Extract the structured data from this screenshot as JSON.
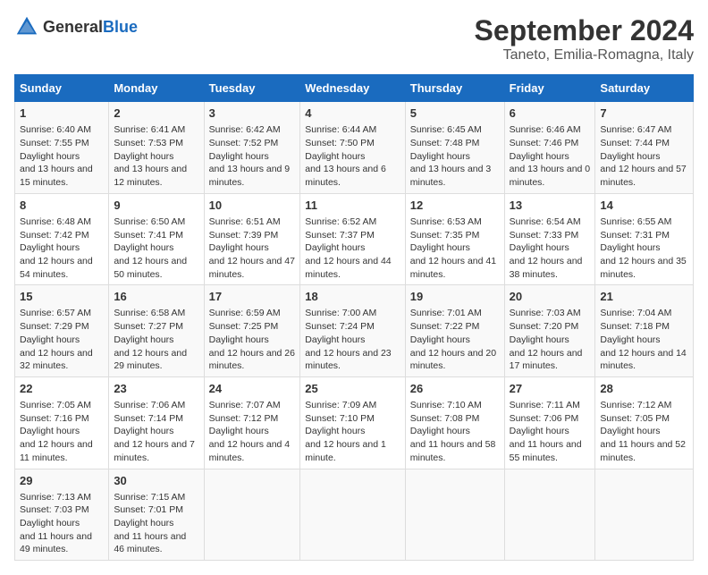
{
  "logo": {
    "text_general": "General",
    "text_blue": "Blue"
  },
  "title": "September 2024",
  "subtitle": "Taneto, Emilia-Romagna, Italy",
  "days_of_week": [
    "Sunday",
    "Monday",
    "Tuesday",
    "Wednesday",
    "Thursday",
    "Friday",
    "Saturday"
  ],
  "weeks": [
    [
      {
        "day": "1",
        "sunrise": "6:40 AM",
        "sunset": "7:55 PM",
        "daylight": "13 hours and 15 minutes."
      },
      {
        "day": "2",
        "sunrise": "6:41 AM",
        "sunset": "7:53 PM",
        "daylight": "13 hours and 12 minutes."
      },
      {
        "day": "3",
        "sunrise": "6:42 AM",
        "sunset": "7:52 PM",
        "daylight": "13 hours and 9 minutes."
      },
      {
        "day": "4",
        "sunrise": "6:44 AM",
        "sunset": "7:50 PM",
        "daylight": "13 hours and 6 minutes."
      },
      {
        "day": "5",
        "sunrise": "6:45 AM",
        "sunset": "7:48 PM",
        "daylight": "13 hours and 3 minutes."
      },
      {
        "day": "6",
        "sunrise": "6:46 AM",
        "sunset": "7:46 PM",
        "daylight": "13 hours and 0 minutes."
      },
      {
        "day": "7",
        "sunrise": "6:47 AM",
        "sunset": "7:44 PM",
        "daylight": "12 hours and 57 minutes."
      }
    ],
    [
      {
        "day": "8",
        "sunrise": "6:48 AM",
        "sunset": "7:42 PM",
        "daylight": "12 hours and 54 minutes."
      },
      {
        "day": "9",
        "sunrise": "6:50 AM",
        "sunset": "7:41 PM",
        "daylight": "12 hours and 50 minutes."
      },
      {
        "day": "10",
        "sunrise": "6:51 AM",
        "sunset": "7:39 PM",
        "daylight": "12 hours and 47 minutes."
      },
      {
        "day": "11",
        "sunrise": "6:52 AM",
        "sunset": "7:37 PM",
        "daylight": "12 hours and 44 minutes."
      },
      {
        "day": "12",
        "sunrise": "6:53 AM",
        "sunset": "7:35 PM",
        "daylight": "12 hours and 41 minutes."
      },
      {
        "day": "13",
        "sunrise": "6:54 AM",
        "sunset": "7:33 PM",
        "daylight": "12 hours and 38 minutes."
      },
      {
        "day": "14",
        "sunrise": "6:55 AM",
        "sunset": "7:31 PM",
        "daylight": "12 hours and 35 minutes."
      }
    ],
    [
      {
        "day": "15",
        "sunrise": "6:57 AM",
        "sunset": "7:29 PM",
        "daylight": "12 hours and 32 minutes."
      },
      {
        "day": "16",
        "sunrise": "6:58 AM",
        "sunset": "7:27 PM",
        "daylight": "12 hours and 29 minutes."
      },
      {
        "day": "17",
        "sunrise": "6:59 AM",
        "sunset": "7:25 PM",
        "daylight": "12 hours and 26 minutes."
      },
      {
        "day": "18",
        "sunrise": "7:00 AM",
        "sunset": "7:24 PM",
        "daylight": "12 hours and 23 minutes."
      },
      {
        "day": "19",
        "sunrise": "7:01 AM",
        "sunset": "7:22 PM",
        "daylight": "12 hours and 20 minutes."
      },
      {
        "day": "20",
        "sunrise": "7:03 AM",
        "sunset": "7:20 PM",
        "daylight": "12 hours and 17 minutes."
      },
      {
        "day": "21",
        "sunrise": "7:04 AM",
        "sunset": "7:18 PM",
        "daylight": "12 hours and 14 minutes."
      }
    ],
    [
      {
        "day": "22",
        "sunrise": "7:05 AM",
        "sunset": "7:16 PM",
        "daylight": "12 hours and 11 minutes."
      },
      {
        "day": "23",
        "sunrise": "7:06 AM",
        "sunset": "7:14 PM",
        "daylight": "12 hours and 7 minutes."
      },
      {
        "day": "24",
        "sunrise": "7:07 AM",
        "sunset": "7:12 PM",
        "daylight": "12 hours and 4 minutes."
      },
      {
        "day": "25",
        "sunrise": "7:09 AM",
        "sunset": "7:10 PM",
        "daylight": "12 hours and 1 minute."
      },
      {
        "day": "26",
        "sunrise": "7:10 AM",
        "sunset": "7:08 PM",
        "daylight": "11 hours and 58 minutes."
      },
      {
        "day": "27",
        "sunrise": "7:11 AM",
        "sunset": "7:06 PM",
        "daylight": "11 hours and 55 minutes."
      },
      {
        "day": "28",
        "sunrise": "7:12 AM",
        "sunset": "7:05 PM",
        "daylight": "11 hours and 52 minutes."
      }
    ],
    [
      {
        "day": "29",
        "sunrise": "7:13 AM",
        "sunset": "7:03 PM",
        "daylight": "11 hours and 49 minutes."
      },
      {
        "day": "30",
        "sunrise": "7:15 AM",
        "sunset": "7:01 PM",
        "daylight": "11 hours and 46 minutes."
      },
      null,
      null,
      null,
      null,
      null
    ]
  ]
}
